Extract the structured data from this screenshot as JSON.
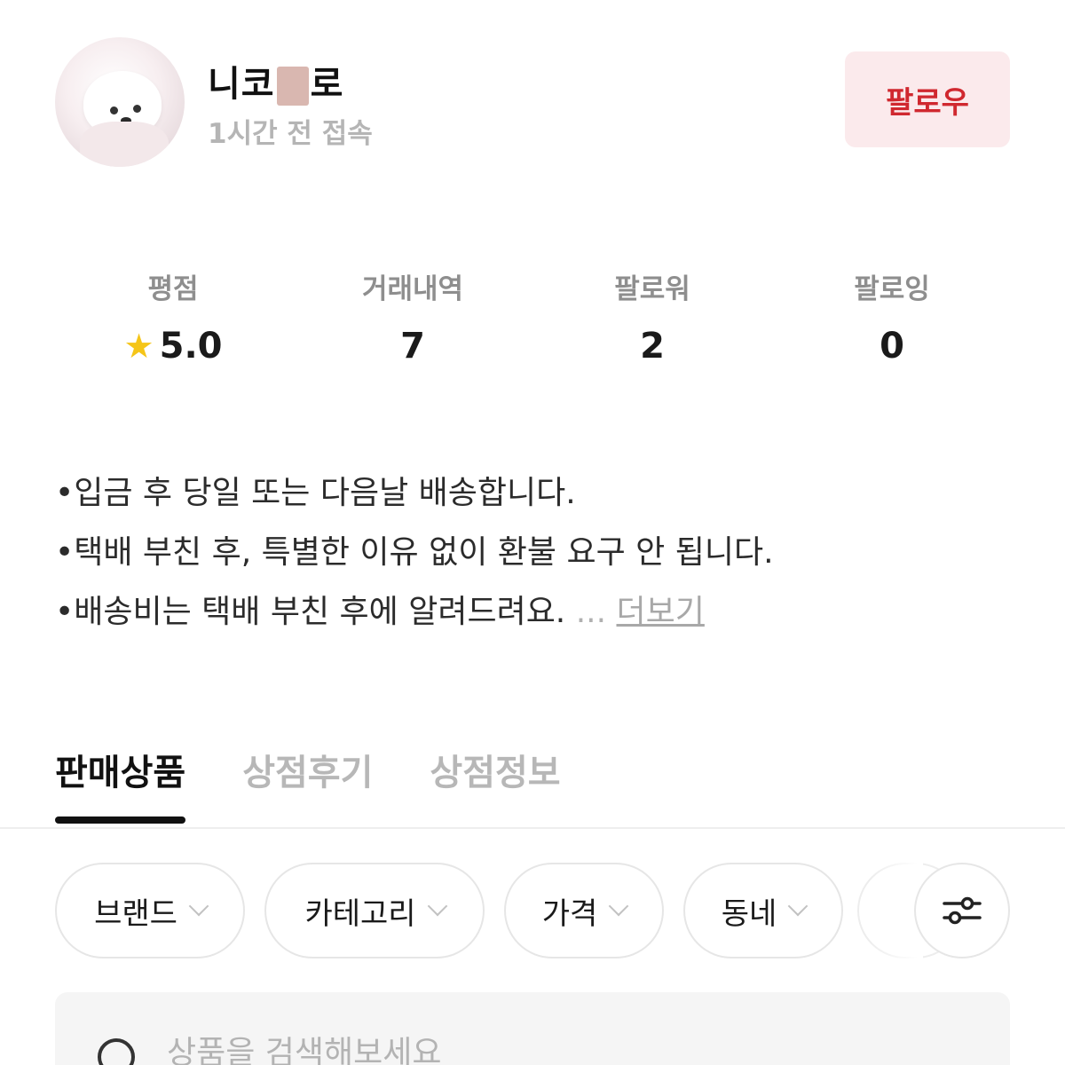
{
  "profile": {
    "name_prefix": "니코",
    "name_suffix": "로",
    "last_seen": "1시간 전 접속",
    "follow_label": "팔로우"
  },
  "stats": [
    {
      "label": "평점",
      "value": "5.0",
      "icon": "star-icon"
    },
    {
      "label": "거래내역",
      "value": "7"
    },
    {
      "label": "팔로워",
      "value": "2"
    },
    {
      "label": "팔로잉",
      "value": "0"
    }
  ],
  "intro": {
    "lines": [
      "•입금 후 당일 또는 다음날 배송합니다.",
      "•택배 부친 후, 특별한 이유 없이 환불 요구 안 됩니다.",
      "•배송비는 택배 부친 후에 알려드려요."
    ],
    "ellipsis": " ... ",
    "more_label": "더보기"
  },
  "tabs": [
    {
      "label": "판매상품",
      "active": true
    },
    {
      "label": "상점후기",
      "active": false
    },
    {
      "label": "상점정보",
      "active": false
    }
  ],
  "filters": [
    {
      "label": "브랜드"
    },
    {
      "label": "카테고리"
    },
    {
      "label": "가격"
    },
    {
      "label": "동네"
    }
  ],
  "filter_settings_icon": "sliders-icon",
  "search": {
    "placeholder": "상품을 검색해보세요"
  },
  "colors": {
    "accent": "#d0282f",
    "follow_bg": "#fbeaec",
    "star": "#f5c518"
  }
}
